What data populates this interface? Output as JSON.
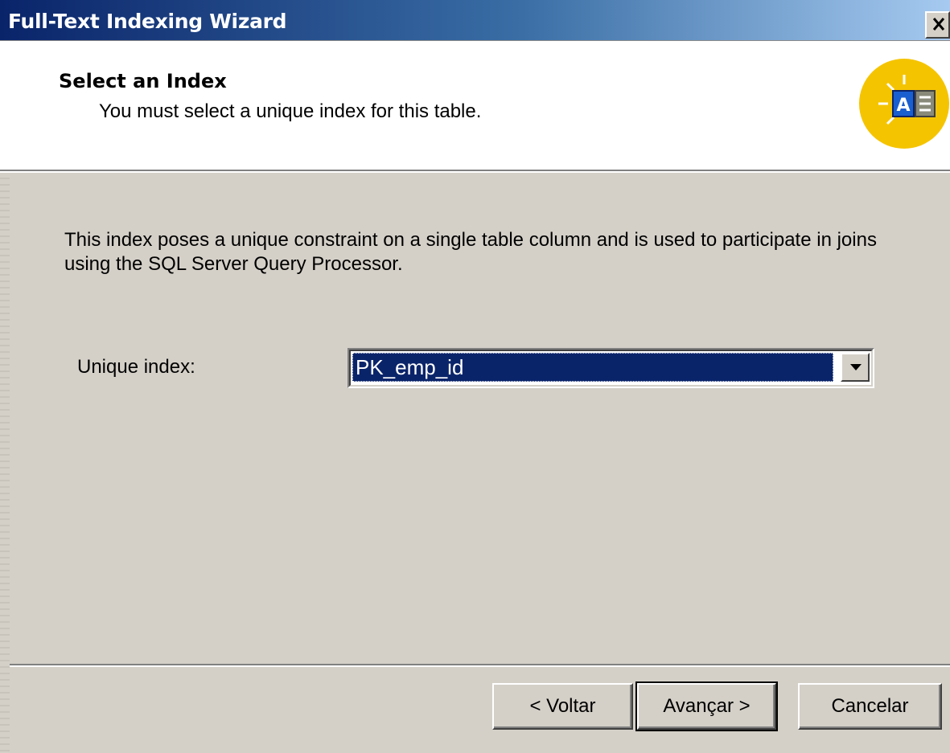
{
  "window": {
    "title": "Full-Text Indexing Wizard",
    "close_glyph": "×"
  },
  "header": {
    "title": "Select an Index",
    "subtitle": "You must select a unique index for this table.",
    "icon": "full-text-wizard-icon",
    "icon_letter": "A"
  },
  "body": {
    "description": "This index poses a unique constraint on a single table column and is used to participate in joins using the SQL Server Query Processor.",
    "unique_index_label": "Unique index:",
    "unique_index_value": "PK_emp_id"
  },
  "buttons": {
    "back": "< Voltar",
    "next": "Avançar >",
    "cancel": "Cancelar"
  },
  "colors": {
    "titlebar_start": "#0a246a",
    "titlebar_end": "#a6caf0",
    "selection": "#0a246a",
    "dialog_face": "#d4d0c8",
    "icon_badge": "#f5c400"
  }
}
